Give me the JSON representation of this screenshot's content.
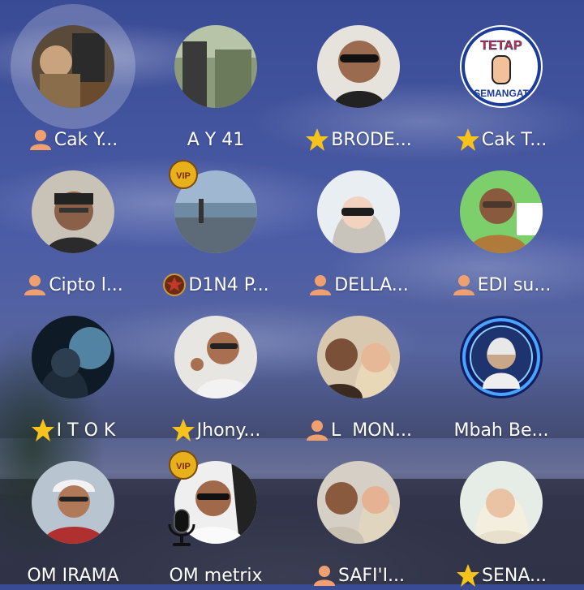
{
  "participants": [
    {
      "name": "Cak Y...",
      "badge": "person-icon",
      "speaking": true
    },
    {
      "name": "A Y 41",
      "badge": ""
    },
    {
      "name": "BRODE...",
      "badge": "star-icon"
    },
    {
      "name": "Cak T...",
      "badge": "star-icon",
      "avatar_text_top": "TETAP",
      "avatar_text_bottom": "SEMANGAT"
    },
    {
      "name": "Cipto l...",
      "badge": "person-icon"
    },
    {
      "name": "D1N4 P...",
      "badge": "medal-star-icon",
      "vip": true,
      "vip_label": "VIP"
    },
    {
      "name": "DELLA...",
      "badge": "person-icon"
    },
    {
      "name": "EDI su...",
      "badge": "person-icon"
    },
    {
      "name": "I T O K",
      "badge": "star-icon"
    },
    {
      "name": "Jhony...",
      "badge": "star-icon"
    },
    {
      "name": "L  MON...",
      "badge": "person-icon"
    },
    {
      "name": "Mbah Be...",
      "badge": "",
      "ring": true
    },
    {
      "name": "OM IRAMA",
      "badge": ""
    },
    {
      "name": "OM metrix",
      "badge": "",
      "vip": true,
      "vip_label": "VIP",
      "mic": true
    },
    {
      "name": "SAFI'I...",
      "badge": "person-icon"
    },
    {
      "name": "SENA...",
      "badge": "star-icon"
    }
  ],
  "colors": {
    "person_badge": "#f0a070",
    "star_badge": "#f6c21c",
    "medal_badge": "#c0392b",
    "text": "#ffffff"
  }
}
